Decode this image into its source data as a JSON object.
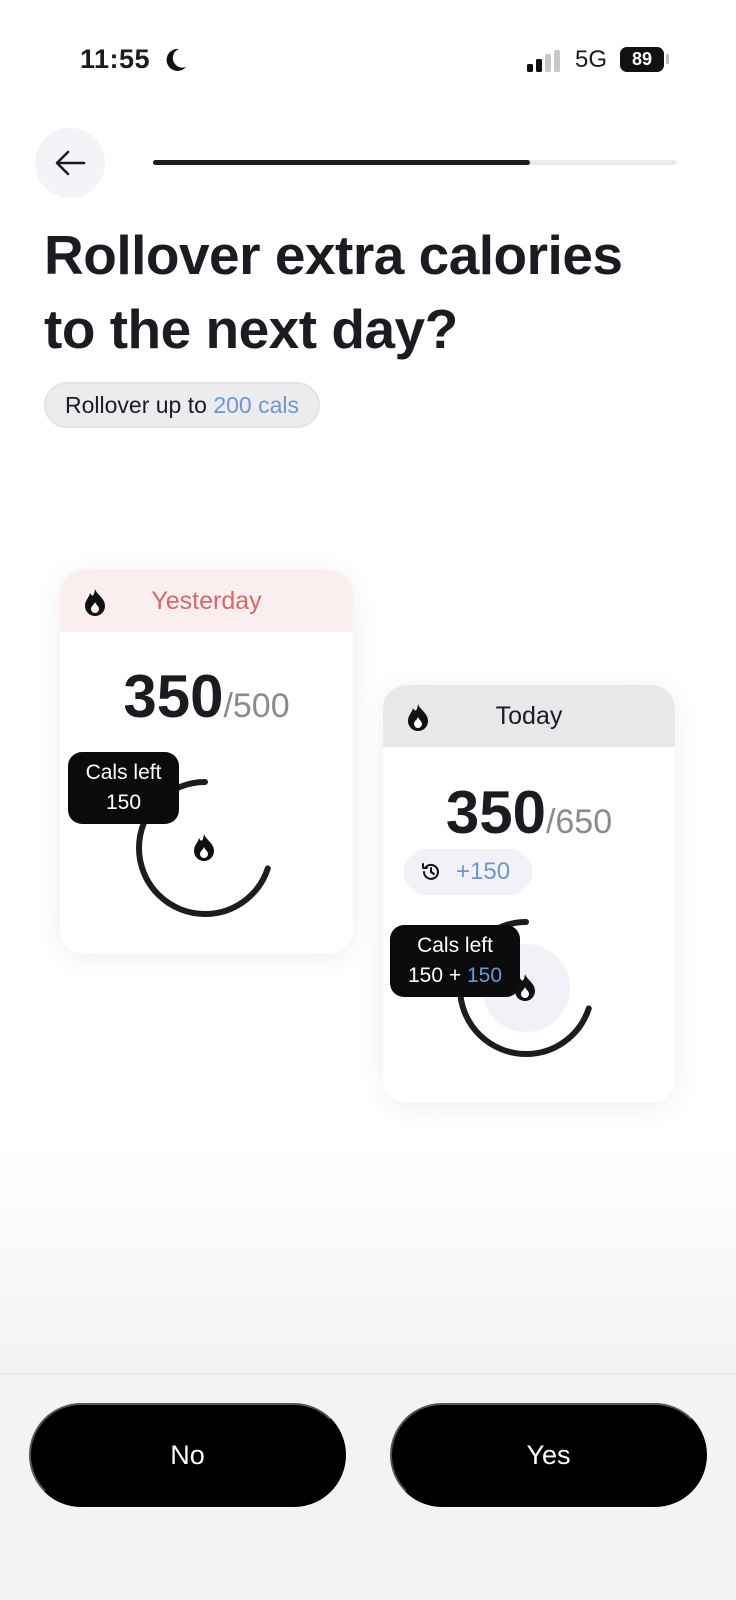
{
  "status_bar": {
    "time": "11:55",
    "network": "5G",
    "battery": "89"
  },
  "onboarding": {
    "progress_percent": 72
  },
  "header": {
    "title_line1": "Rollover extra calories",
    "title_line2": "to the next day?",
    "pill_prefix": "Rollover up to ",
    "pill_value": "200 cals"
  },
  "yesterday_card": {
    "label": "Yesterday",
    "consumed": "350",
    "goal": "/500",
    "tooltip_title": "Cals left",
    "tooltip_value": "150",
    "ring_fraction": 0.7
  },
  "today_card": {
    "label": "Today",
    "consumed": "350",
    "goal": "/650",
    "rollover_badge": "+150",
    "tooltip_title": "Cals left",
    "tooltip_base": "150",
    "tooltip_plus": " + ",
    "tooltip_rollover": "150",
    "ring_fraction": 0.7
  },
  "actions": {
    "no_label": "No",
    "yes_label": "Yes"
  },
  "colors": {
    "accent": "#6e97d0",
    "yesterday_label": "#d4696b",
    "yesterday_header": "#fbeeee",
    "today_header": "#e8e8ea",
    "ring": "#1c1c22"
  }
}
